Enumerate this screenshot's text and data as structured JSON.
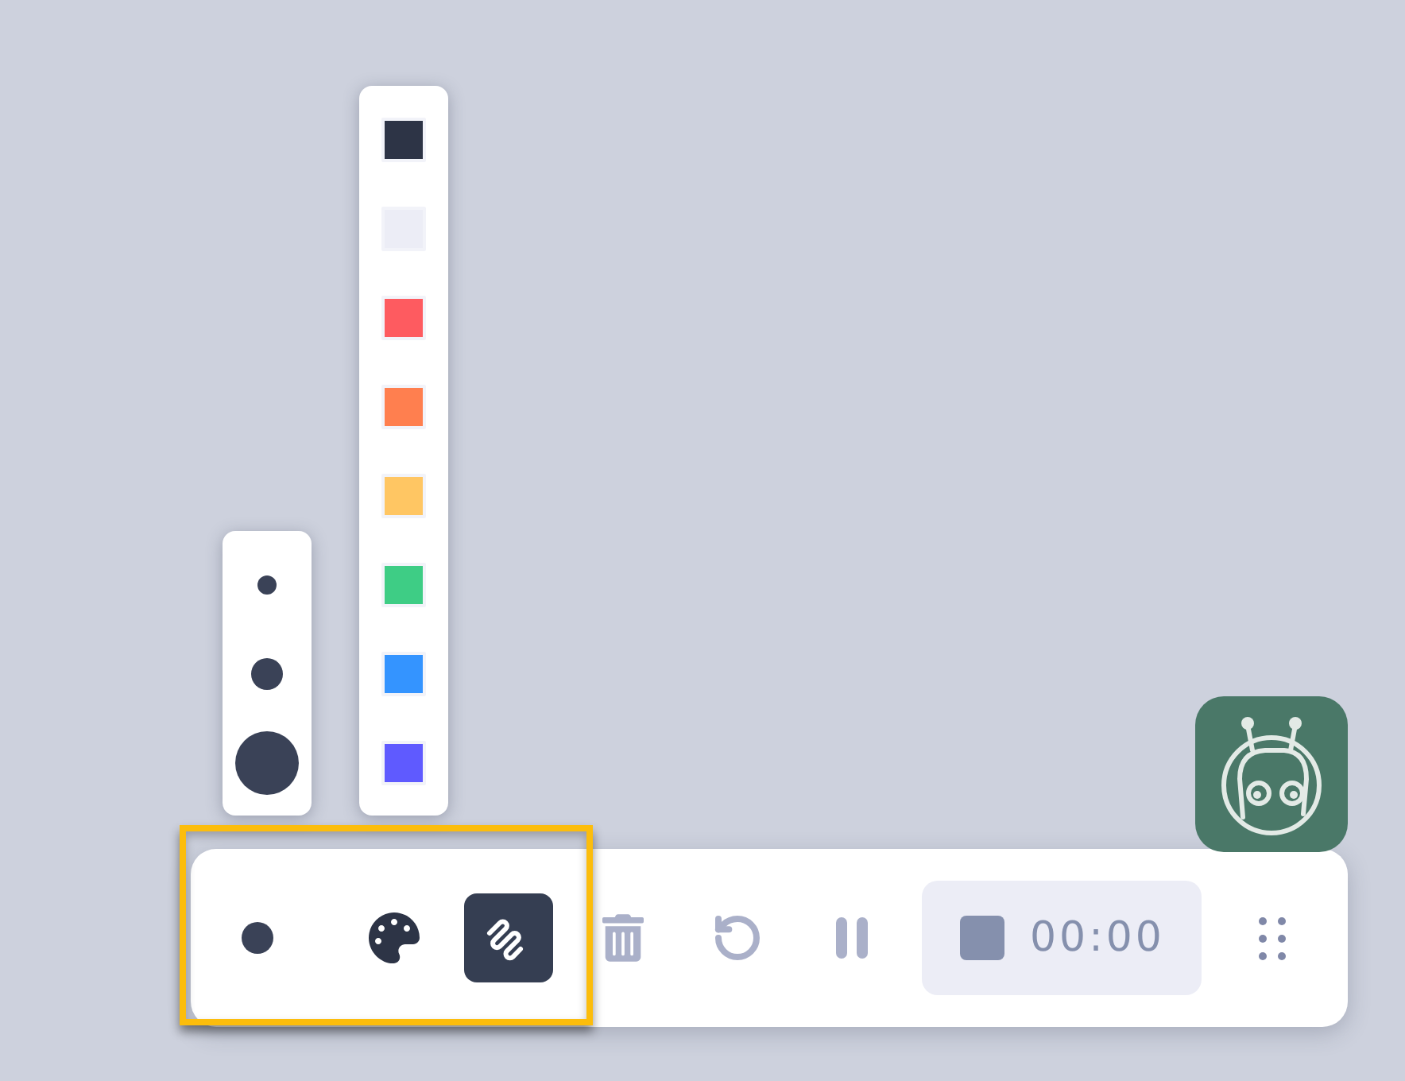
{
  "brush_sizes": [
    {
      "kind": "small"
    },
    {
      "kind": "medium"
    },
    {
      "kind": "large"
    }
  ],
  "colors": [
    {
      "color": "#2d3446"
    },
    {
      "color": "#ecedf6"
    },
    {
      "color": "#fe5b60"
    },
    {
      "color": "#ff7f4f"
    },
    {
      "color": "#ffc663"
    },
    {
      "color": "#3ecd85"
    },
    {
      "color": "#3494ff"
    },
    {
      "color": "#5f5aff"
    }
  ],
  "toolbar": {
    "tools": [
      {
        "kind": "brush",
        "dot": {
          "kind": "medium"
        },
        "selected": false
      },
      {
        "kind": "palette",
        "selected": false
      },
      {
        "kind": "pen",
        "selected": true
      }
    ],
    "actions": [
      {
        "kind": "trash",
        "disabled": true
      },
      {
        "kind": "undo",
        "disabled": true
      },
      {
        "kind": "pause",
        "disabled": true
      }
    ],
    "timer": {
      "time": "00:00"
    }
  }
}
